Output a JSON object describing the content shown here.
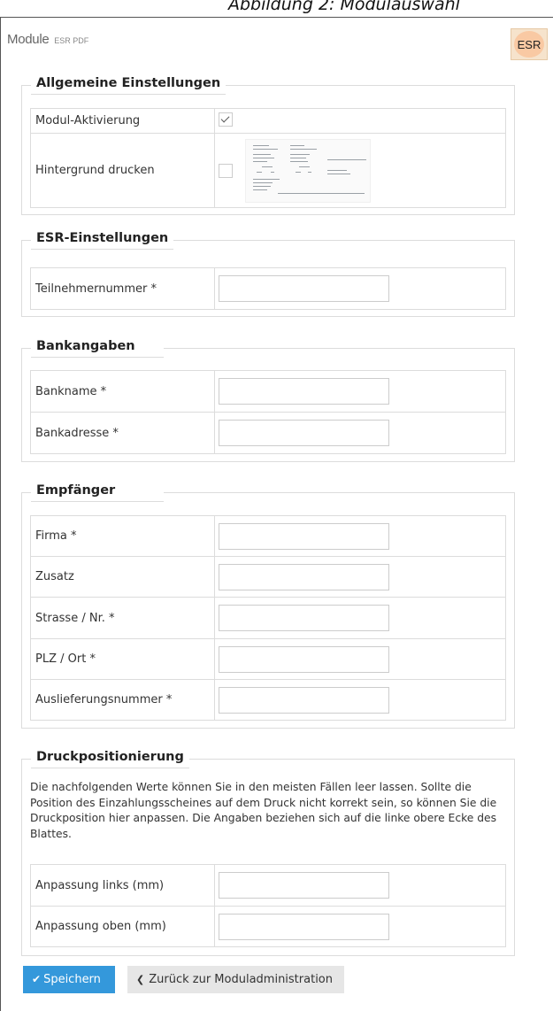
{
  "caption": "Abbildung 2: Modulauswahl",
  "header": {
    "module_label": "Module",
    "module_sub": "ESR PDF",
    "logo_text": "ESR"
  },
  "sections": {
    "allgemein": {
      "title": "Allgemeine Einstellungen",
      "rows": [
        {
          "label": "Modul-Aktivierung",
          "checked": true
        },
        {
          "label": "Hintergrund drucken",
          "checked": false
        }
      ]
    },
    "esr": {
      "title": "ESR-Einstellungen",
      "rows": [
        {
          "label": "Teilnehmernummer *",
          "value": ""
        }
      ]
    },
    "bank": {
      "title": "Bankangaben",
      "rows": [
        {
          "label": "Bankname *",
          "value": ""
        },
        {
          "label": "Bankadresse *",
          "value": ""
        }
      ]
    },
    "empfaenger": {
      "title": "Empfänger",
      "rows": [
        {
          "label": "Firma *",
          "value": ""
        },
        {
          "label": "Zusatz",
          "value": ""
        },
        {
          "label": "Strasse / Nr. *",
          "value": ""
        },
        {
          "label": "PLZ / Ort *",
          "value": ""
        },
        {
          "label": "Auslieferungsnummer *",
          "value": ""
        }
      ]
    },
    "druck": {
      "title": "Druckpositionierung",
      "description": "Die nachfolgenden Werte können Sie in den meisten Fällen leer lassen. Sollte die Position des Einzahlungsscheines auf dem Druck nicht korrekt sein, so können Sie die Druckposition hier anpassen. Die Angaben beziehen sich auf die linke obere Ecke des Blattes.",
      "rows": [
        {
          "label": "Anpassung links (mm)",
          "value": ""
        },
        {
          "label": "Anpassung oben (mm)",
          "value": ""
        }
      ]
    }
  },
  "buttons": {
    "save_label": "Speichern",
    "back_label": "Zurück zur Moduladministration",
    "save_icon": "check-icon",
    "back_icon": "chevron-left-icon"
  },
  "colors": {
    "primary": "#3498db",
    "secondary_button": "#e6e6e6",
    "border": "#dcdcdc",
    "logo_bg": "#f9c9a3"
  }
}
